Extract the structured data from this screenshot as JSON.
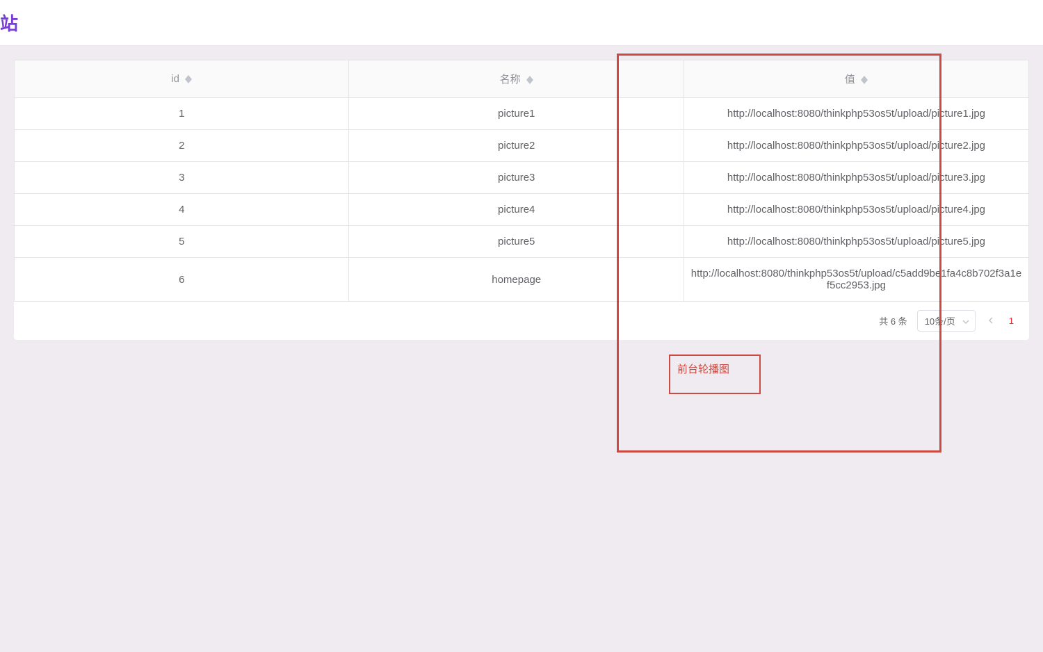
{
  "header": {
    "title": "站"
  },
  "table": {
    "columns": {
      "id": "id",
      "name": "名称",
      "value": "值"
    },
    "rows": [
      {
        "id": "1",
        "name": "picture1",
        "value": "http://localhost:8080/thinkphp53os5t/upload/picture1.jpg"
      },
      {
        "id": "2",
        "name": "picture2",
        "value": "http://localhost:8080/thinkphp53os5t/upload/picture2.jpg"
      },
      {
        "id": "3",
        "name": "picture3",
        "value": "http://localhost:8080/thinkphp53os5t/upload/picture3.jpg"
      },
      {
        "id": "4",
        "name": "picture4",
        "value": "http://localhost:8080/thinkphp53os5t/upload/picture4.jpg"
      },
      {
        "id": "5",
        "name": "picture5",
        "value": "http://localhost:8080/thinkphp53os5t/upload/picture5.jpg"
      },
      {
        "id": "6",
        "name": "homepage",
        "value": "http://localhost:8080/thinkphp53os5t/upload/c5add9be1fa4c8b702f3a1ef5cc2953.jpg"
      }
    ]
  },
  "pagination": {
    "total_text": "共 6 条",
    "page_size_label": "10条/页",
    "current_page": "1"
  },
  "annotation": {
    "label": "前台轮播图"
  }
}
